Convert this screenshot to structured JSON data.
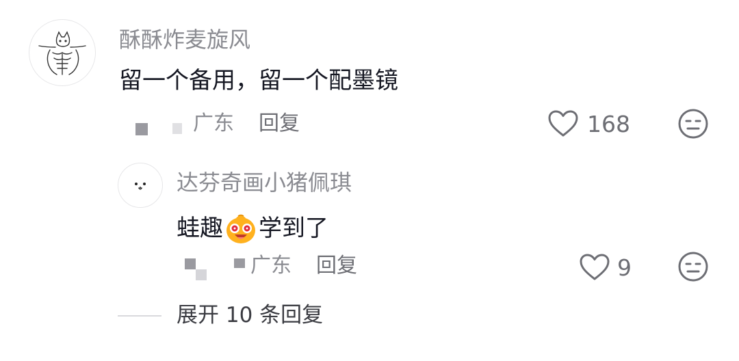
{
  "comment": {
    "username": "酥酥炸麦旋风",
    "text": "留一个备用，留一个配墨镜",
    "location": "广东",
    "reply_label": "回复",
    "like_count": "168",
    "avatar_icon": "muscle-cat-sketch-icon",
    "like_icon": "heart-outline-icon",
    "reaction_icon": "expressionless-face-icon"
  },
  "reply": {
    "username": "达芬奇画小猪佩琪",
    "text_before_emoji": "蛙趣",
    "emoji": "excited-face-emoji",
    "text_after_emoji": "学到了",
    "location": "广东",
    "reply_label": "回复",
    "like_count": "9",
    "avatar_icon": "dog-face-sketch-icon",
    "like_icon": "heart-outline-icon",
    "reaction_icon": "expressionless-face-icon"
  },
  "expand": {
    "label": "展开 10 条回复"
  },
  "colors": {
    "primary_text": "#161823",
    "secondary_text": "#8a8b91",
    "icon": "#6d6e74",
    "emoji_fill": "#ffb11e"
  }
}
